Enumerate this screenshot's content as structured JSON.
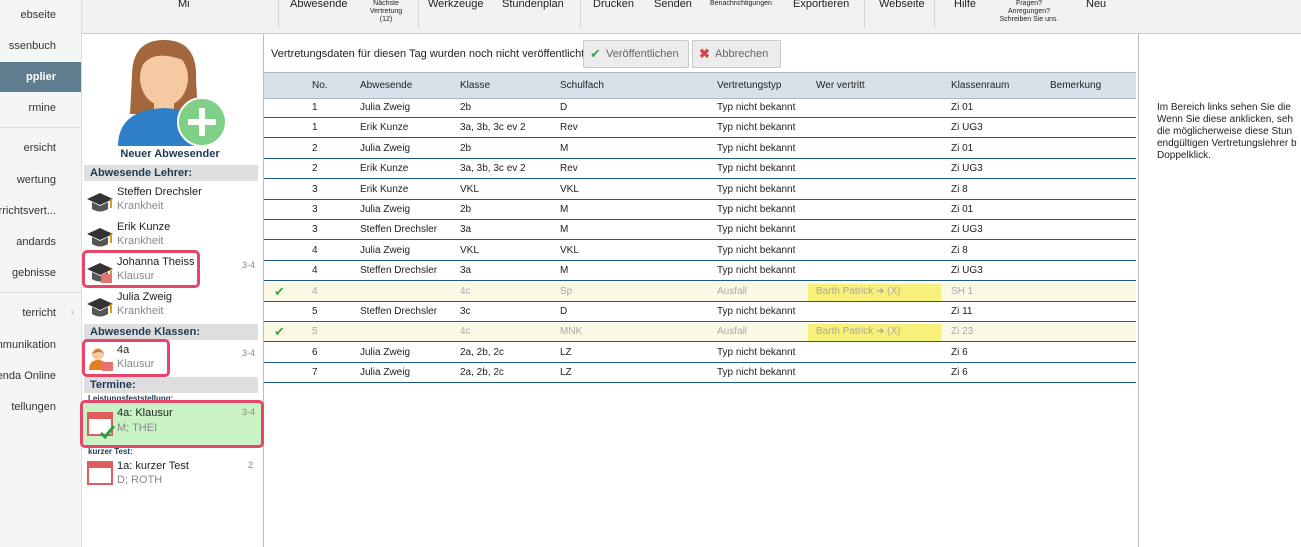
{
  "nav": {
    "items": [
      {
        "label": "ebseite"
      },
      {
        "label": "ssenbuch"
      },
      {
        "label": "pplier"
      },
      {
        "label": "rmine"
      },
      {
        "label": "ersicht"
      },
      {
        "label": "wertung"
      },
      {
        "label": "terrichtsvert..."
      },
      {
        "label": "andards"
      },
      {
        "label": "gebnisse"
      },
      {
        "label": "terricht"
      },
      {
        "label": "mmunikation"
      },
      {
        "label": "enda Online"
      },
      {
        "label": "tellungen"
      }
    ]
  },
  "toolbar": {
    "mi": "Mi",
    "abwesende": "Abwesende",
    "naechste_vertretung": "Nächste Vertretung",
    "naechste_count": "(12)",
    "werkzeuge": "Werkzeuge",
    "stundenplan": "Stundenplan",
    "drucken": "Drucken",
    "senden": "Senden",
    "benachrichtigungen": "Benachrichtigungen",
    "exportieren": "Exportieren",
    "webseite": "Webseite",
    "hilfe": "Hilfe",
    "fragen": "Fragen?",
    "anregungen": "Anregungen?",
    "schreiben": "Schreiben Sie uns.",
    "neu": "Neu"
  },
  "absent": {
    "new_absentee_label": "Neuer Abwesender",
    "teachers_heading": "Abwesende Lehrer:",
    "teachers": [
      {
        "name": "Steffen Drechsler",
        "reason": "Krankheit",
        "period": ""
      },
      {
        "name": "Erik Kunze",
        "reason": "Krankheit",
        "period": ""
      },
      {
        "name": "Johanna Theiss",
        "reason": "Klausur",
        "period": "3-4"
      },
      {
        "name": "Julia Zweig",
        "reason": "Krankheit",
        "period": ""
      }
    ],
    "classes_heading": "Abwesende Klassen:",
    "classes": [
      {
        "name": "4a",
        "reason": "Klausur",
        "period": "3-4"
      }
    ],
    "events_heading": "Termine:",
    "event_groups": [
      {
        "group": "Leistungsfeststellung:",
        "title": "4a: Klausur",
        "detail": "M; THEI",
        "period": "3-4"
      },
      {
        "group": "kurzer Test:",
        "title": "1a: kurzer Test",
        "detail": "D; ROTH",
        "period": "2"
      }
    ]
  },
  "main": {
    "publish_message": "Vertretungsdaten für diesen Tag wurden noch nicht veröffentlicht.",
    "publish_button": "Veröffentlichen",
    "cancel_button": "Abbrechen",
    "columns": [
      "No.",
      "Abwesende",
      "Klasse",
      "Schulfach",
      "Vertretungstyp",
      "Wer vertritt",
      "Klassenraum",
      "Bemerkung"
    ],
    "rows": [
      {
        "check": false,
        "no": "1",
        "absent": "Julia Zweig",
        "class": "2b",
        "subject": "D",
        "type": "Typ nicht bekannt",
        "sub": "",
        "room": "Zi 01",
        "note": "",
        "cancel": false
      },
      {
        "check": false,
        "no": "1",
        "absent": "Erik Kunze",
        "class": "3a, 3b, 3c ev 2",
        "subject": "Rev",
        "type": "Typ nicht bekannt",
        "sub": "",
        "room": "Zi UG3",
        "note": "",
        "cancel": false
      },
      {
        "check": false,
        "no": "2",
        "absent": "Julia Zweig",
        "class": "2b",
        "subject": "M",
        "type": "Typ nicht bekannt",
        "sub": "",
        "room": "Zi 01",
        "note": "",
        "cancel": false
      },
      {
        "check": false,
        "no": "2",
        "absent": "Erik Kunze",
        "class": "3a, 3b, 3c ev 2",
        "subject": "Rev",
        "type": "Typ nicht bekannt",
        "sub": "",
        "room": "Zi UG3",
        "note": "",
        "cancel": false
      },
      {
        "check": false,
        "no": "3",
        "absent": "Erik Kunze",
        "class": "VKL",
        "subject": "VKL",
        "type": "Typ nicht bekannt",
        "sub": "",
        "room": "Zi 8",
        "note": "",
        "cancel": false
      },
      {
        "check": false,
        "no": "3",
        "absent": "Julia Zweig",
        "class": "2b",
        "subject": "M",
        "type": "Typ nicht bekannt",
        "sub": "",
        "room": "Zi 01",
        "note": "",
        "cancel": false
      },
      {
        "check": false,
        "no": "3",
        "absent": "Steffen Drechsler",
        "class": "3a",
        "subject": "M",
        "type": "Typ nicht bekannt",
        "sub": "",
        "room": "Zi UG3",
        "note": "",
        "cancel": false
      },
      {
        "check": false,
        "no": "4",
        "absent": "Julia Zweig",
        "class": "VKL",
        "subject": "VKL",
        "type": "Typ nicht bekannt",
        "sub": "",
        "room": "Zi 8",
        "note": "",
        "cancel": false
      },
      {
        "check": false,
        "no": "4",
        "absent": "Steffen Drechsler",
        "class": "3a",
        "subject": "M",
        "type": "Typ nicht bekannt",
        "sub": "",
        "room": "Zi UG3",
        "note": "",
        "cancel": false
      },
      {
        "check": true,
        "no": "4",
        "absent": "",
        "class": "4c",
        "subject": "Sp",
        "type": "Ausfall",
        "sub": "Barth Patrick ➜ (X)",
        "room": "SH 1",
        "note": "",
        "cancel": true
      },
      {
        "check": false,
        "no": "5",
        "absent": "Steffen Drechsler",
        "class": "3c",
        "subject": "D",
        "type": "Typ nicht bekannt",
        "sub": "",
        "room": "Zi 11",
        "note": "",
        "cancel": false
      },
      {
        "check": true,
        "no": "5",
        "absent": "",
        "class": "4c",
        "subject": "MNK",
        "type": "Ausfall",
        "sub": "Barth Patrick ➜ (X)",
        "room": "Zi 23",
        "note": "",
        "cancel": true
      },
      {
        "check": false,
        "no": "6",
        "absent": "Julia Zweig",
        "class": "2a, 2b, 2c",
        "subject": "LZ",
        "type": "Typ nicht bekannt",
        "sub": "",
        "room": "Zi 6",
        "note": "",
        "cancel": false
      },
      {
        "check": false,
        "no": "7",
        "absent": "Julia Zweig",
        "class": "2a, 2b, 2c",
        "subject": "LZ",
        "type": "Typ nicht bekannt",
        "sub": "",
        "room": "Zi 6",
        "note": "",
        "cancel": false
      }
    ]
  },
  "info": {
    "lines": [
      "Im Bereich links sehen Sie die",
      "Wenn Sie diese anklicken, seh",
      "die möglicherweise diese Stun",
      "endgültigen Vertretungslehrer b",
      "Doppelklick."
    ]
  },
  "colors": {
    "accent": "#5f7d8e",
    "highlight": "#e8456a",
    "cancel_row": "#fbf9e3",
    "substitute_chip": "#f7f07a",
    "grid_line": "#1d5a8a",
    "event_green": "#c9f3c4"
  }
}
